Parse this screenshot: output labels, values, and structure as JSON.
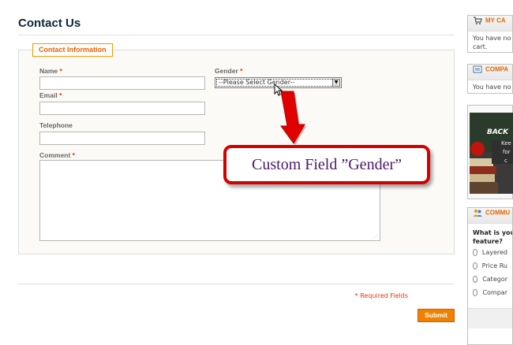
{
  "page": {
    "title": "Contact Us"
  },
  "form": {
    "legend": "Contact Information",
    "name_label": "Name",
    "email_label": "Email",
    "telephone_label": "Telephone",
    "comment_label": "Comment",
    "gender_label": "Gender",
    "required_mark": "*",
    "gender_select_value": "--Please Select Gender--",
    "required_note": "* Required Fields",
    "submit_label": "Submit"
  },
  "annotation": {
    "text": "Custom Field ”Gender”"
  },
  "sidebar": {
    "cart": {
      "title": "MY CA",
      "body_line1": "You have no",
      "body_line2": "cart."
    },
    "compare": {
      "title": "COMPA",
      "body": "You have no"
    },
    "promo": {
      "line1": "BACK",
      "line2": "Kee",
      "line3": "for",
      "line4": "c"
    },
    "poll": {
      "title": "COMMU",
      "question_line1": "What is you",
      "question_line2": "feature?",
      "options": [
        "Layered",
        "Price Ru",
        "Categor",
        "Compar"
      ]
    }
  },
  "colors": {
    "accent": "#e26703",
    "callout_border": "#d40000",
    "submit_bg": "#f18200"
  },
  "icons": {
    "cart": "cart-icon",
    "compare": "compare-icon",
    "poll": "community-icon",
    "cursor": "mouse-pointer-icon",
    "arrow": "red-arrow-icon"
  }
}
